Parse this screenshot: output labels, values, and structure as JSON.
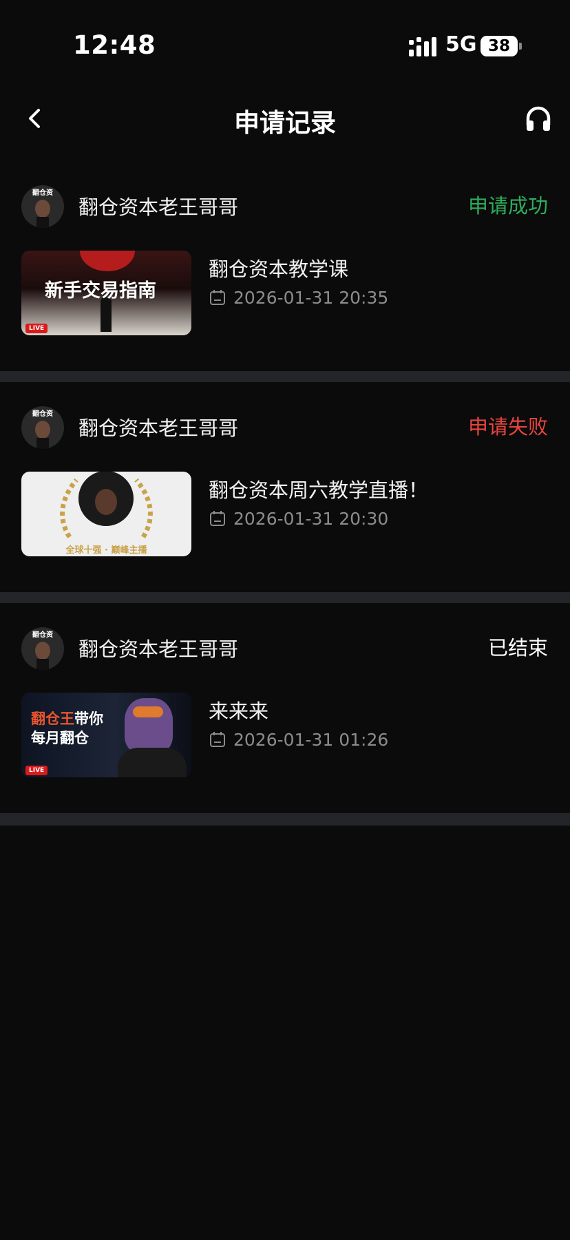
{
  "status_bar": {
    "time": "12:48",
    "network": "5G",
    "battery": "38"
  },
  "header": {
    "title": "申请记录",
    "back_icon": "chevron-left-icon",
    "service_icon": "headset-icon"
  },
  "colors": {
    "success": "#2dae5b",
    "failed": "#e8443d",
    "ended": "#ffffff",
    "background": "#0b0b0c",
    "divider": "#242528"
  },
  "records": [
    {
      "host": "翻仓资本老王哥哥",
      "status": "申请成功",
      "course": "翻仓资本教学课",
      "date": "2026-01-31 20:35",
      "thumb_text": "新手交易指南",
      "live_badge": "LIVE"
    },
    {
      "host": "翻仓资本老王哥哥",
      "status": "申请失败",
      "course": "翻仓资本周六教学直播！",
      "date": "2026-01-31 20:30",
      "thumb_text": "全球十强 · 巅峰主播"
    },
    {
      "host": "翻仓资本老王哥哥",
      "status": "已结束",
      "course": "来来来",
      "date": "2026-01-31 01:26",
      "thumb_text_a": "翻仓王",
      "thumb_text_b": "带你",
      "thumb_text_c": "每月翻仓",
      "live_badge": "LIVE"
    }
  ]
}
